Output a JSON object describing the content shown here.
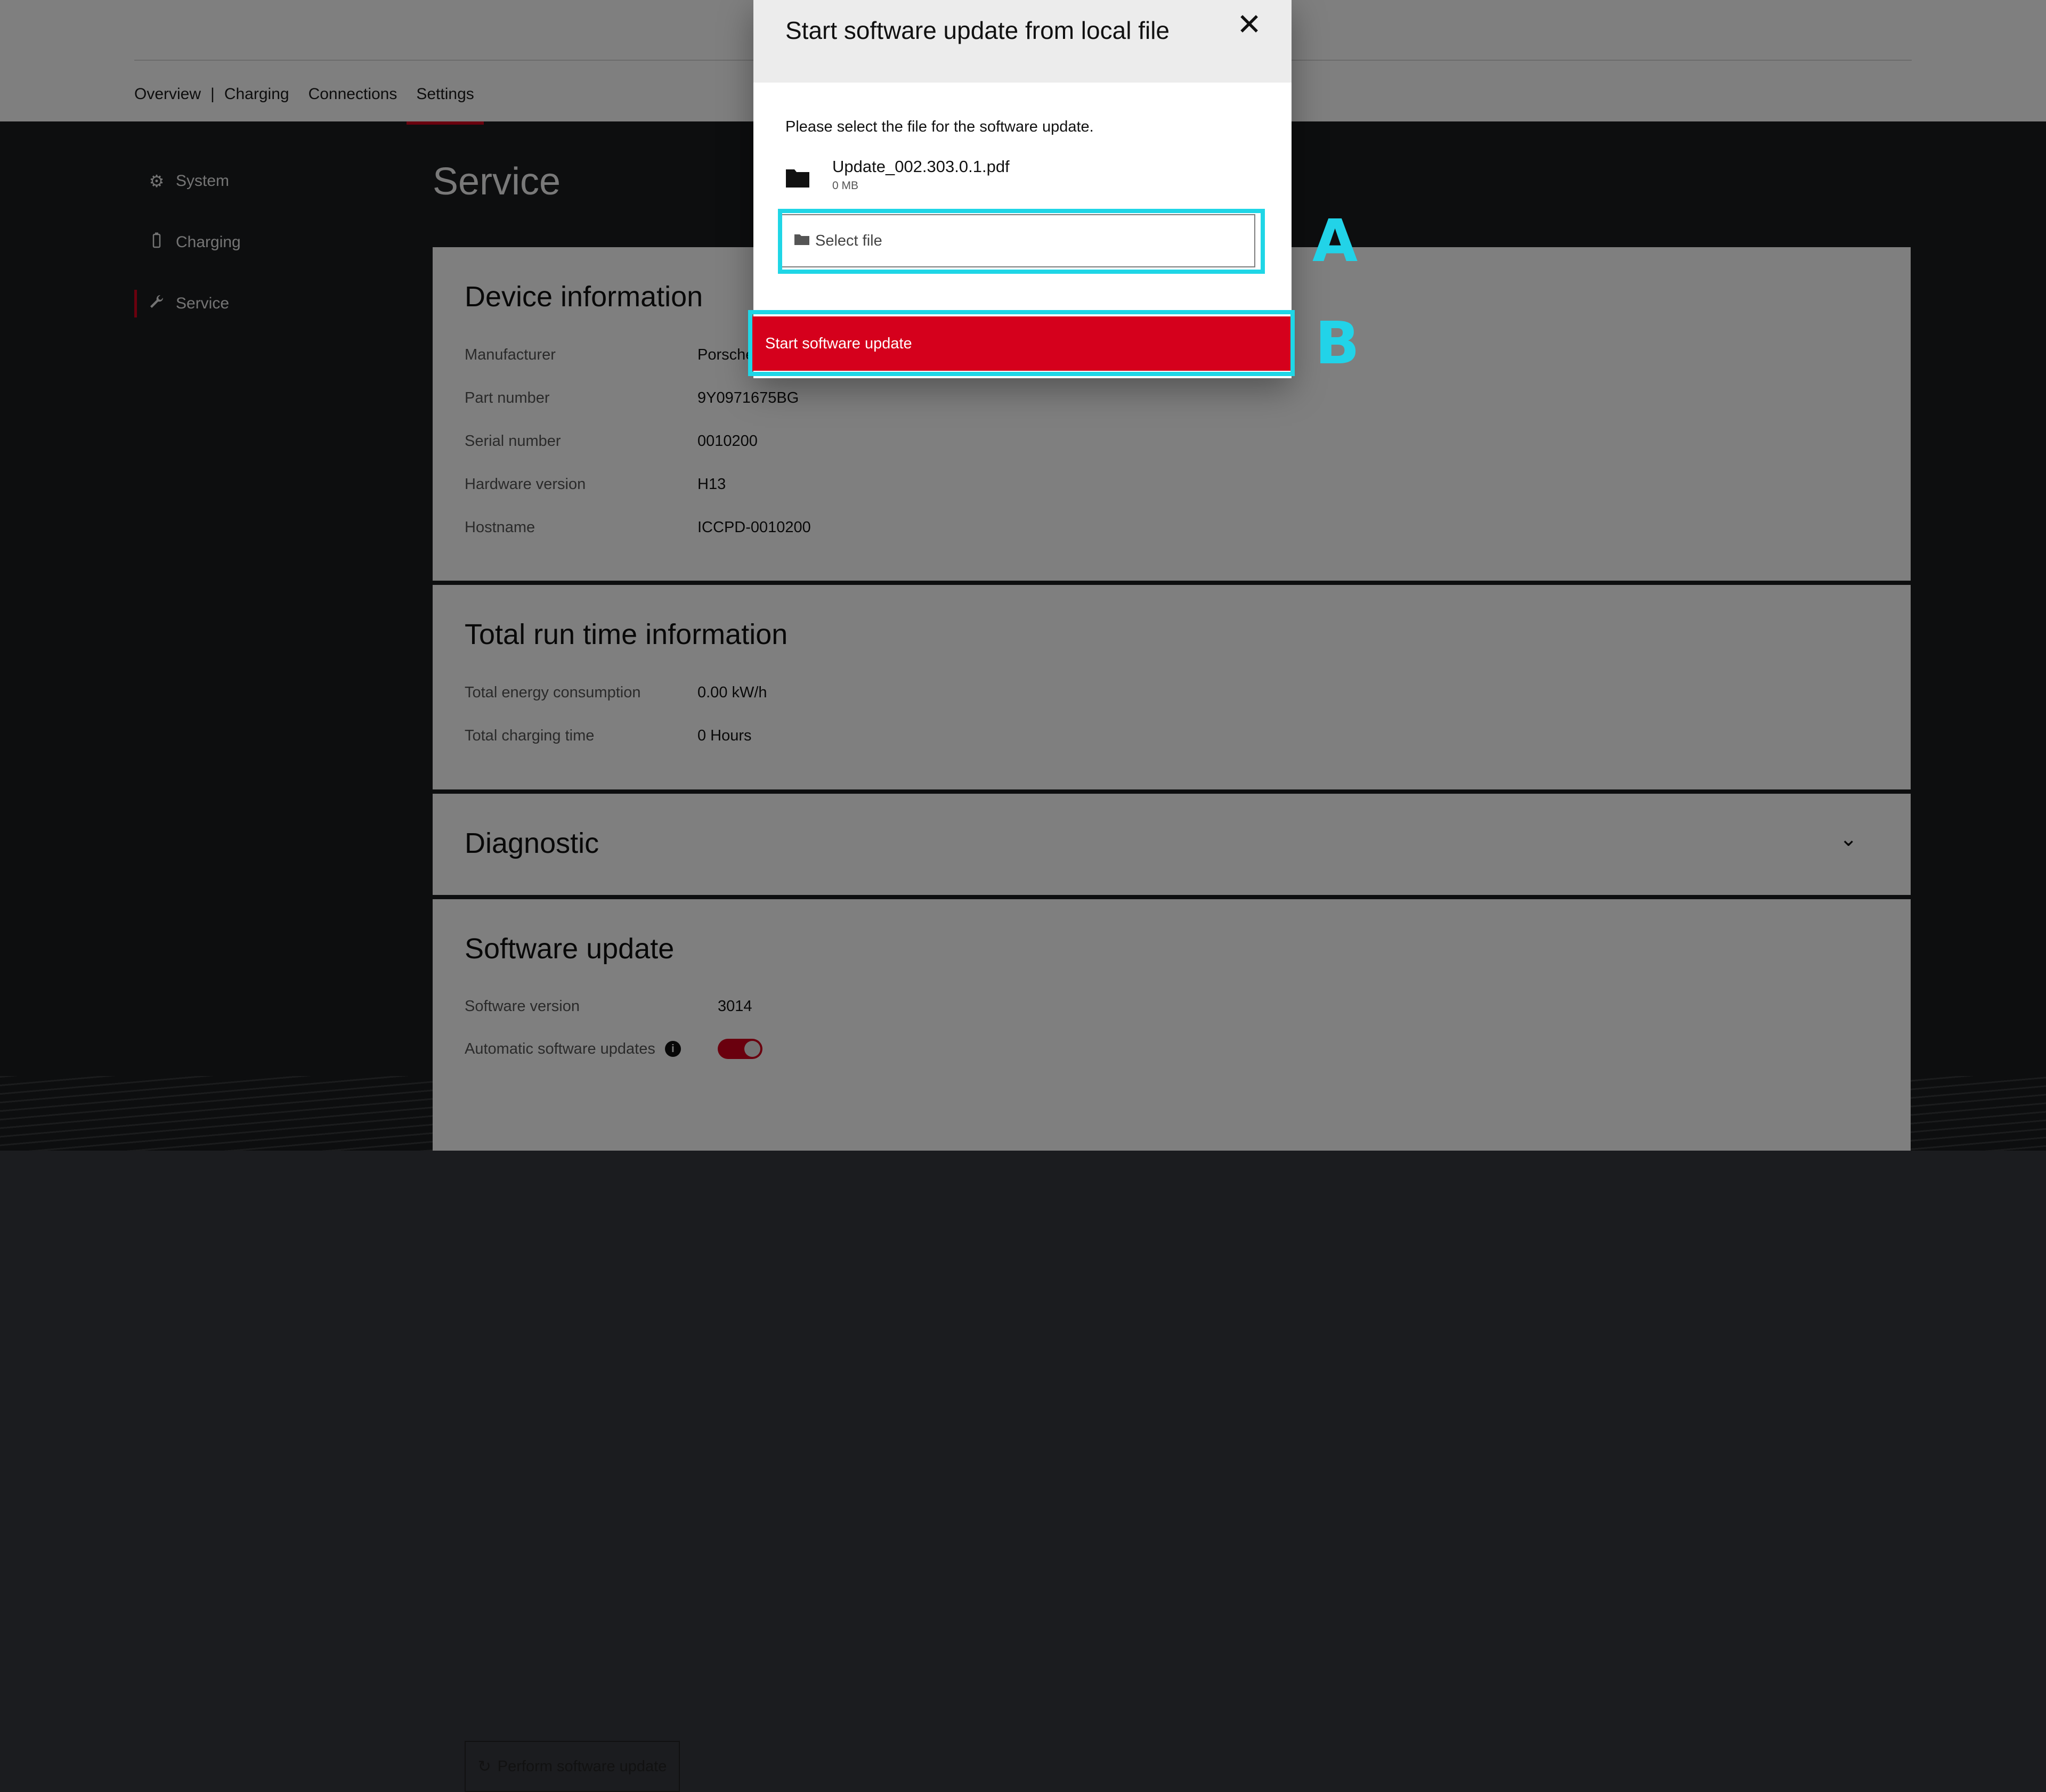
{
  "topnav": {
    "items": [
      {
        "label": "Overview"
      },
      {
        "label": "Charging"
      },
      {
        "label": "Connections"
      },
      {
        "label": "Settings",
        "active": true
      }
    ],
    "separator": "|"
  },
  "sidebar": {
    "items": [
      {
        "label": "System",
        "icon": "gear-icon"
      },
      {
        "label": "Charging",
        "icon": "battery-icon"
      },
      {
        "label": "Service",
        "icon": "wrench-icon",
        "active": true
      }
    ]
  },
  "page": {
    "title": "Service"
  },
  "device_info": {
    "title": "Device information",
    "rows": [
      {
        "label": "Manufacturer",
        "value": "Porsche"
      },
      {
        "label": "Part number",
        "value": "9Y0971675BG"
      },
      {
        "label": "Serial number",
        "value": "0010200"
      },
      {
        "label": "Hardware version",
        "value": "H13"
      },
      {
        "label": "Hostname",
        "value": "ICCPD-0010200"
      }
    ]
  },
  "runtime": {
    "title": "Total run time information",
    "rows": [
      {
        "label": "Total energy consumption",
        "value": "0.00 kW/h"
      },
      {
        "label": "Total charging time",
        "value": "0 Hours"
      }
    ]
  },
  "diagnostic": {
    "title": "Diagnostic"
  },
  "software_update": {
    "title": "Software update",
    "version_label": "Software version",
    "version_value": "3014",
    "auto_label": "Automatic software updates",
    "auto_enabled": true,
    "perform_label": "Perform software update"
  },
  "modal": {
    "title": "Start software update from local file",
    "close_symbol": "✕",
    "instruction": "Please select the file for the software update.",
    "file_name": "Update_002.303.0.1.pdf",
    "file_size": "0 MB",
    "select_label": "Select file",
    "start_label": "Start software update"
  },
  "annotations": {
    "a": "A",
    "b": "B",
    "color": "#1fd6e6"
  },
  "colors": {
    "accent": "#d5001c",
    "background": "#1b1c1f"
  }
}
